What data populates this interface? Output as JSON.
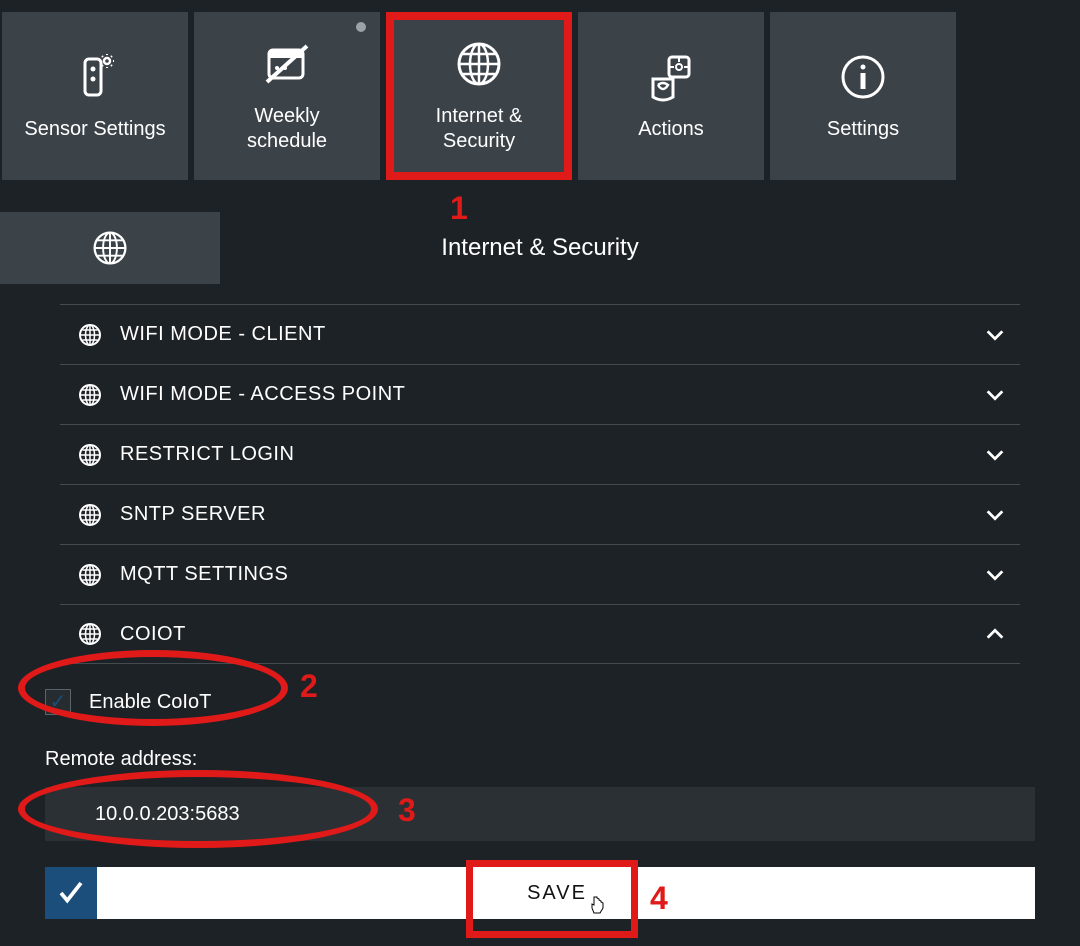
{
  "tabs": [
    {
      "label": "Sensor Settings"
    },
    {
      "label": "Weekly\nschedule"
    },
    {
      "label": "Internet &\nSecurity"
    },
    {
      "label": "Actions"
    },
    {
      "label": "Settings"
    }
  ],
  "section": {
    "title": "Internet & Security"
  },
  "accordion": [
    {
      "label": "WIFI MODE - CLIENT",
      "expanded": false
    },
    {
      "label": "WIFI MODE - ACCESS POINT",
      "expanded": false
    },
    {
      "label": "RESTRICT LOGIN",
      "expanded": false
    },
    {
      "label": "SNTP SERVER",
      "expanded": false
    },
    {
      "label": "MQTT SETTINGS",
      "expanded": false
    },
    {
      "label": "COIOT",
      "expanded": true
    }
  ],
  "coiot": {
    "enable_label": "Enable CoIoT",
    "remote_label": "Remote address:",
    "remote_value": "10.0.0.203:5683",
    "save_label": "SAVE"
  },
  "annotations": {
    "n1": "1",
    "n2": "2",
    "n3": "3",
    "n4": "4"
  }
}
